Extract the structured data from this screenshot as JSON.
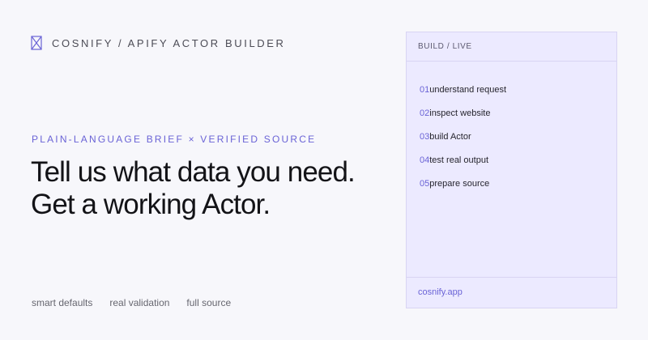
{
  "brand": {
    "logo_icon": "hourglass-x-icon",
    "name": "COSNIFY / APIFY ACTOR BUILDER"
  },
  "hero": {
    "eyebrow": "PLAIN-LANGUAGE BRIEF × VERIFIED SOURCE",
    "headline_line1": "Tell us what data you need.",
    "headline_line2": "Get a working Actor."
  },
  "features": [
    "smart defaults",
    "real validation",
    "full source"
  ],
  "panel": {
    "title": "BUILD / LIVE",
    "steps": [
      {
        "num": "01",
        "label": "understand request"
      },
      {
        "num": "02",
        "label": "inspect website"
      },
      {
        "num": "03",
        "label": "build Actor"
      },
      {
        "num": "04",
        "label": "test real output"
      },
      {
        "num": "05",
        "label": "prepare source"
      }
    ],
    "footer_link": "cosnify.app"
  },
  "colors": {
    "accent": "#6a63d6",
    "background": "#f7f7fb",
    "panel_background": "#eceaff",
    "panel_border": "#d8d4f3"
  }
}
